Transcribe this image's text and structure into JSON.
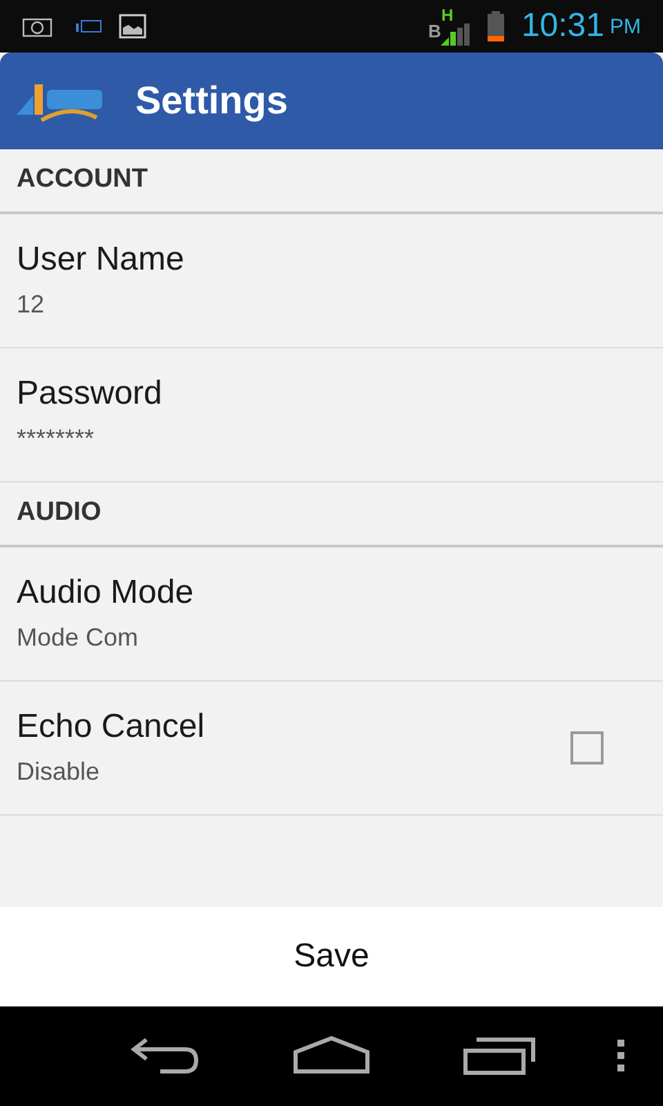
{
  "status_bar": {
    "sim": "B",
    "network": "H",
    "time": "10:31",
    "meridiem": "PM"
  },
  "action_bar": {
    "title": "Settings"
  },
  "sections": [
    {
      "header": "ACCOUNT",
      "items": [
        {
          "kind": "text",
          "title": "User Name",
          "summary": "12"
        },
        {
          "kind": "text",
          "title": "Password",
          "summary": "********"
        }
      ]
    },
    {
      "header": "AUDIO",
      "items": [
        {
          "kind": "text",
          "title": "Audio Mode",
          "summary": "Mode Com"
        },
        {
          "kind": "checkbox",
          "title": "Echo Cancel",
          "summary": "Disable",
          "checked": false
        }
      ]
    }
  ],
  "save_button": "Save"
}
